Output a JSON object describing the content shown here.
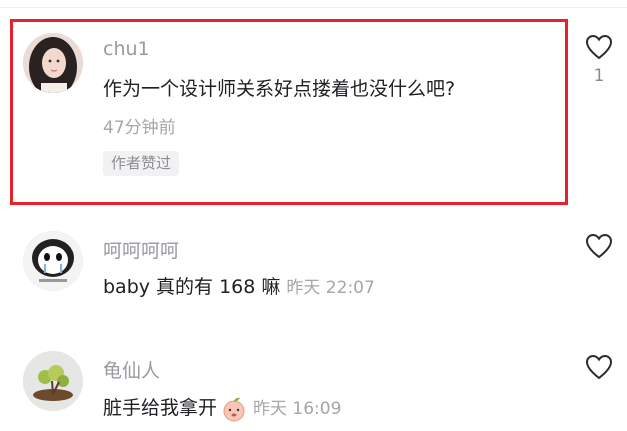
{
  "comments": [
    {
      "username": "chu1",
      "text": "作为一个设计师关系好点搂着也没什么吧?",
      "time": "47分钟前",
      "badge": "作者赞过",
      "likes": "1",
      "avatar": "woman-portrait",
      "like_icon": "heart-outline-icon",
      "highlighted": true
    },
    {
      "username": "呵呵呵呵",
      "text": "baby 真的有 168 嘛",
      "time": "昨天 22:07",
      "avatar": "crying-meme-face",
      "like_icon": "heart-outline-icon"
    },
    {
      "username": "龟仙人",
      "text": "脏手给我拿开",
      "time": "昨天 16:09",
      "emoji": "peach-face-emoji",
      "avatar": "bonsai-plant",
      "like_icon": "heart-outline-icon"
    }
  ],
  "colors": {
    "highlight_border": "#e8202a",
    "username": "#9a9aa0",
    "text": "#1f1f24",
    "meta": "#a5a5aa"
  }
}
